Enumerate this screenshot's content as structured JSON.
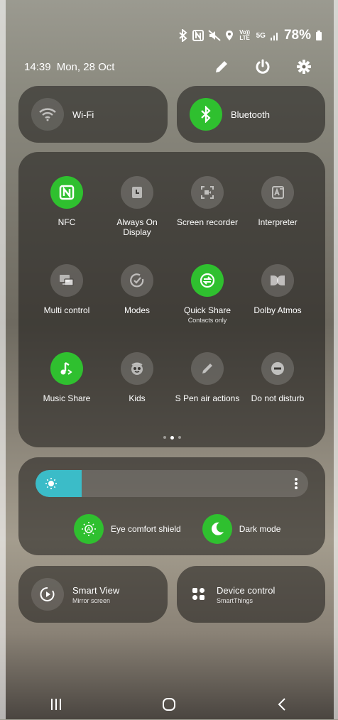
{
  "status_bar": {
    "icons": [
      "bluetooth-icon",
      "nfc-icon",
      "mute-icon",
      "location-icon",
      "volte-icon",
      "5g-icon",
      "signal-icon",
      "battery-icon"
    ],
    "volte_label": "Vo)) LTE",
    "network": "5G",
    "battery": "78%"
  },
  "header": {
    "time": "14:39",
    "date": "Mon, 28 Oct",
    "icons": [
      "edit-icon",
      "power-icon",
      "settings-icon"
    ]
  },
  "top_pills": [
    {
      "label": "Wi-Fi",
      "on": false
    },
    {
      "label": "Bluetooth",
      "on": true
    }
  ],
  "tiles": [
    {
      "label": "NFC",
      "on": true
    },
    {
      "label": "Always On Display",
      "on": false
    },
    {
      "label": "Screen recorder",
      "on": false
    },
    {
      "label": "Interpreter",
      "on": false
    },
    {
      "label": "Multi control",
      "on": false
    },
    {
      "label": "Modes",
      "on": false
    },
    {
      "label": "Quick Share",
      "sub": "Contacts only",
      "on": true
    },
    {
      "label": "Dolby Atmos",
      "on": false
    },
    {
      "label": "Music Share",
      "on": true
    },
    {
      "label": "Kids",
      "on": false
    },
    {
      "label": "S Pen air actions",
      "on": false
    },
    {
      "label": "Do not disturb",
      "on": false
    }
  ],
  "page_indicator": {
    "pages": 3,
    "current": 2
  },
  "brightness": {
    "level": 0.17
  },
  "toggles": [
    {
      "label": "Eye comfort shield",
      "on": true
    },
    {
      "label": "Dark mode",
      "on": true
    }
  ],
  "bottom_pills": [
    {
      "label": "Smart View",
      "sub": "Mirror screen"
    },
    {
      "label": "Device control",
      "sub": "SmartThings"
    }
  ],
  "colors": {
    "on": "#2fc02f",
    "brightness": "#3bbcc8"
  }
}
